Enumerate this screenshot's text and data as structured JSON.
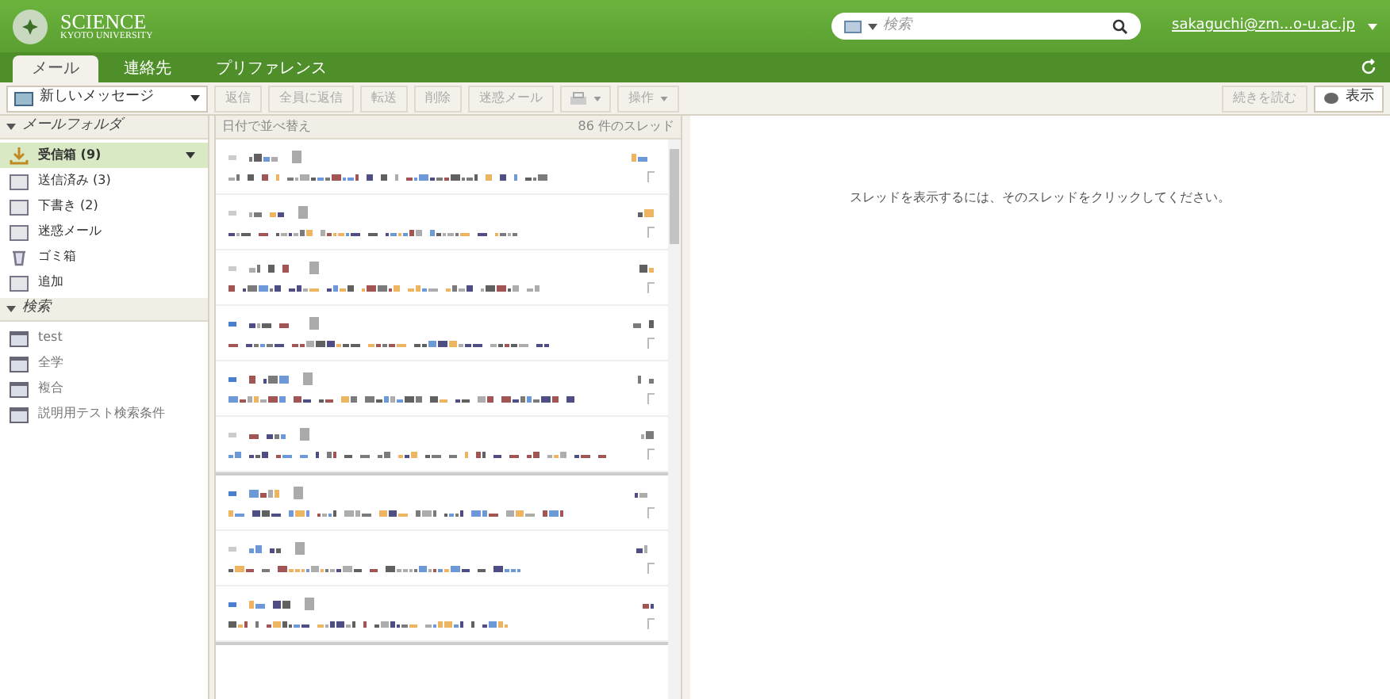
{
  "logo": {
    "title": "SCIENCE",
    "subtitle": "KYOTO UNIVERSITY"
  },
  "search": {
    "placeholder": "検索"
  },
  "user": "sakaguchi@zm...o-u.ac.jp",
  "tabs": [
    {
      "label": "メール",
      "selected": true
    },
    {
      "label": "連絡先",
      "selected": false
    },
    {
      "label": "プリファレンス",
      "selected": false
    }
  ],
  "toolbar": {
    "new_message": "新しいメッセージ",
    "buttons": [
      {
        "label": "返信",
        "kind": "text"
      },
      {
        "label": "全員に返信",
        "kind": "text"
      },
      {
        "label": "転送",
        "kind": "text"
      },
      {
        "label": "削除",
        "kind": "text"
      },
      {
        "label": "迷惑メール",
        "kind": "text"
      },
      {
        "kind": "print"
      },
      {
        "label": "操作",
        "kind": "menu"
      }
    ],
    "read_more": "続きを読む",
    "view": "表示"
  },
  "sidebar": {
    "sections": [
      {
        "title": "メールフォルダ",
        "items": [
          {
            "label": "受信箱 (9)",
            "kind": "inbox",
            "selected": true
          },
          {
            "label": "送信済み (3)",
            "kind": "folder",
            "selected": false
          },
          {
            "label": "下書き (2)",
            "kind": "folder",
            "selected": false
          },
          {
            "label": "迷惑メール",
            "kind": "folder",
            "selected": false
          },
          {
            "label": "ゴミ箱",
            "kind": "trash",
            "selected": false
          },
          {
            "label": "追加",
            "kind": "folder",
            "selected": false
          }
        ]
      },
      {
        "title": "検索",
        "items": [
          {
            "label": "test",
            "kind": "search",
            "selected": false
          },
          {
            "label": "全学",
            "kind": "search",
            "selected": false
          },
          {
            "label": "複合",
            "kind": "search",
            "selected": false
          },
          {
            "label": "説明用テスト検索条件",
            "kind": "search",
            "selected": false
          }
        ]
      }
    ]
  },
  "list": {
    "sort": "日付で並べ替え",
    "count": "86 件のスレッド",
    "groups": [
      [
        {
          "unread": false
        },
        {
          "unread": false
        },
        {
          "unread": false
        },
        {
          "unread": true
        },
        {
          "unread": true
        },
        {
          "unread": false
        }
      ],
      [
        {
          "unread": true
        },
        {
          "unread": false
        },
        {
          "unread": true
        }
      ]
    ]
  },
  "reading_pane": {
    "hint": "スレッドを表示するには、そのスレッドをクリックしてください。"
  }
}
